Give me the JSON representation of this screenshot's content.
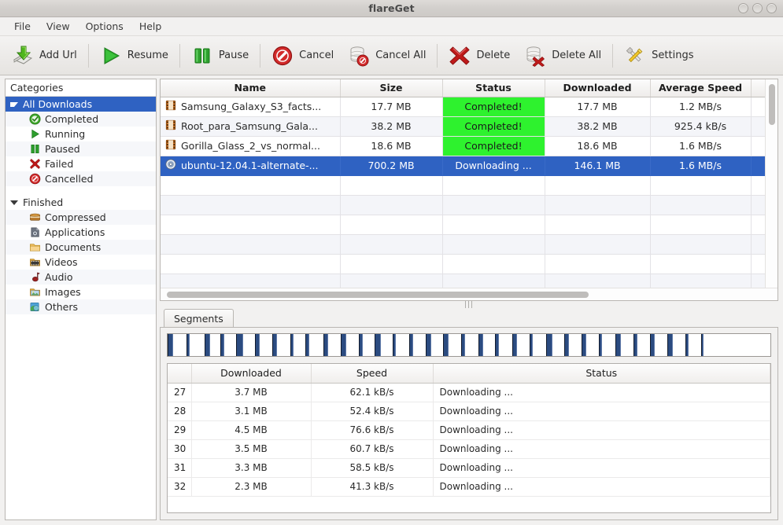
{
  "window": {
    "title": "flareGet",
    "controls": [
      "minimize",
      "maximize",
      "close"
    ]
  },
  "menubar": {
    "items": [
      {
        "label": "File"
      },
      {
        "label": "View"
      },
      {
        "label": "Options"
      },
      {
        "label": "Help"
      }
    ]
  },
  "toolbar": {
    "buttons": [
      {
        "label": "Add Url",
        "icon": "download-arrow-icon"
      },
      {
        "label": "Resume",
        "icon": "play-icon"
      },
      {
        "label": "Pause",
        "icon": "pause-icon"
      },
      {
        "label": "Cancel",
        "icon": "no-entry-icon"
      },
      {
        "label": "Cancel All",
        "icon": "database-no-entry-icon"
      },
      {
        "label": "Delete",
        "icon": "red-x-icon"
      },
      {
        "label": "Delete All",
        "icon": "database-x-icon"
      },
      {
        "label": "Settings",
        "icon": "tools-icon"
      }
    ]
  },
  "sidebar": {
    "header": "Categories",
    "groups": [
      {
        "label": "All Downloads",
        "selected": true,
        "items": [
          {
            "label": "Completed",
            "icon": "check-circle-green-icon"
          },
          {
            "label": "Running",
            "icon": "play-green-icon"
          },
          {
            "label": "Paused",
            "icon": "pause-green-icon"
          },
          {
            "label": "Failed",
            "icon": "red-x-icon"
          },
          {
            "label": "Cancelled",
            "icon": "no-entry-red-icon"
          }
        ]
      },
      {
        "label": "Finished",
        "selected": false,
        "items": [
          {
            "label": "Compressed",
            "icon": "archive-icon"
          },
          {
            "label": "Applications",
            "icon": "application-icon"
          },
          {
            "label": "Documents",
            "icon": "document-folder-icon"
          },
          {
            "label": "Videos",
            "icon": "video-folder-icon"
          },
          {
            "label": "Audio",
            "icon": "audio-icon"
          },
          {
            "label": "Images",
            "icon": "images-folder-icon"
          },
          {
            "label": "Others",
            "icon": "others-globe-icon"
          }
        ]
      }
    ]
  },
  "downloads": {
    "columns": [
      "Name",
      "Size",
      "Status",
      "Downloaded",
      "Average Speed"
    ],
    "rows": [
      {
        "icon": "film-strip-icon",
        "name": "Samsung_Galaxy_S3_facts...",
        "size": "17.7 MB",
        "status": "Completed!",
        "downloaded": "17.7 MB",
        "average_speed": "1.2 MB/s",
        "state": "completed",
        "selected": false
      },
      {
        "icon": "film-strip-icon",
        "name": "Root_para_Samsung_Gala...",
        "size": "38.2 MB",
        "status": "Completed!",
        "downloaded": "38.2 MB",
        "average_speed": "925.4 kB/s",
        "state": "completed",
        "selected": false
      },
      {
        "icon": "film-strip-icon",
        "name": "Gorilla_Glass_2_vs_normal...",
        "size": "18.6 MB",
        "status": "Completed!",
        "downloaded": "18.6 MB",
        "average_speed": "1.6 MB/s",
        "state": "completed",
        "selected": false
      },
      {
        "icon": "disc-icon",
        "name": "ubuntu-12.04.1-alternate-...",
        "size": "700.2 MB",
        "status": "Downloading ...",
        "downloaded": "146.1 MB",
        "average_speed": "1.6 MB/s",
        "state": "downloading",
        "selected": true
      }
    ],
    "empty_row_count": 6
  },
  "segments_panel": {
    "tab_label": "Segments",
    "progress_block_count": 32,
    "columns": [
      "",
      "Downloaded",
      "Speed",
      "Status"
    ],
    "rows": [
      {
        "index": "27",
        "downloaded": "3.7 MB",
        "speed": "62.1 kB/s",
        "status": "Downloading ..."
      },
      {
        "index": "28",
        "downloaded": "3.1 MB",
        "speed": "52.4 kB/s",
        "status": "Downloading ..."
      },
      {
        "index": "29",
        "downloaded": "4.5 MB",
        "speed": "76.6 kB/s",
        "status": "Downloading ..."
      },
      {
        "index": "30",
        "downloaded": "3.5 MB",
        "speed": "60.7 kB/s",
        "status": "Downloading ..."
      },
      {
        "index": "31",
        "downloaded": "3.3 MB",
        "speed": "58.5 kB/s",
        "status": "Downloading ..."
      },
      {
        "index": "32",
        "downloaded": "2.3 MB",
        "speed": "41.3 kB/s",
        "status": "Downloading ..."
      }
    ]
  },
  "colors": {
    "selection_blue": "#2f62c2",
    "completed_green": "#2ef22e",
    "segment_block": "#2b4b80",
    "window_chrome": "#f2f1f0"
  }
}
